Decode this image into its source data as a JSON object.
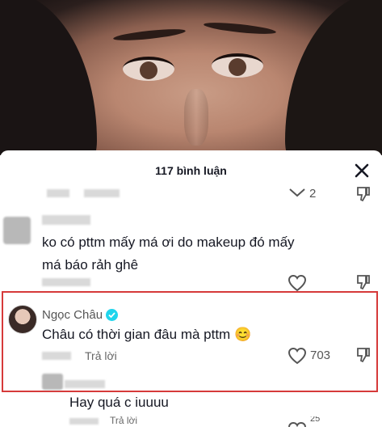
{
  "comments_panel": {
    "title": "117 bình luận"
  },
  "comments": [
    {
      "text": "",
      "like_count": "2"
    },
    {
      "text": "ko có pttm mấy má ơi do makeup đó mấy má báo rảh ghê",
      "like_count": ""
    },
    {
      "author": "Ngọc Châu",
      "verified": true,
      "text": "Châu có thời gian đâu mà pttm 😊",
      "reply_label": "Trả lời",
      "like_count": "703"
    },
    {
      "text": "Hay quá c iuuuu",
      "reply_label": "Trả lời",
      "like_count": "25"
    }
  ],
  "colors": {
    "highlight": "#d63a3a",
    "verified": "#20d5ec"
  },
  "icons": [
    "close-icon",
    "heart-icon",
    "dislike-icon",
    "chevron-down-icon",
    "verified-badge-icon"
  ]
}
